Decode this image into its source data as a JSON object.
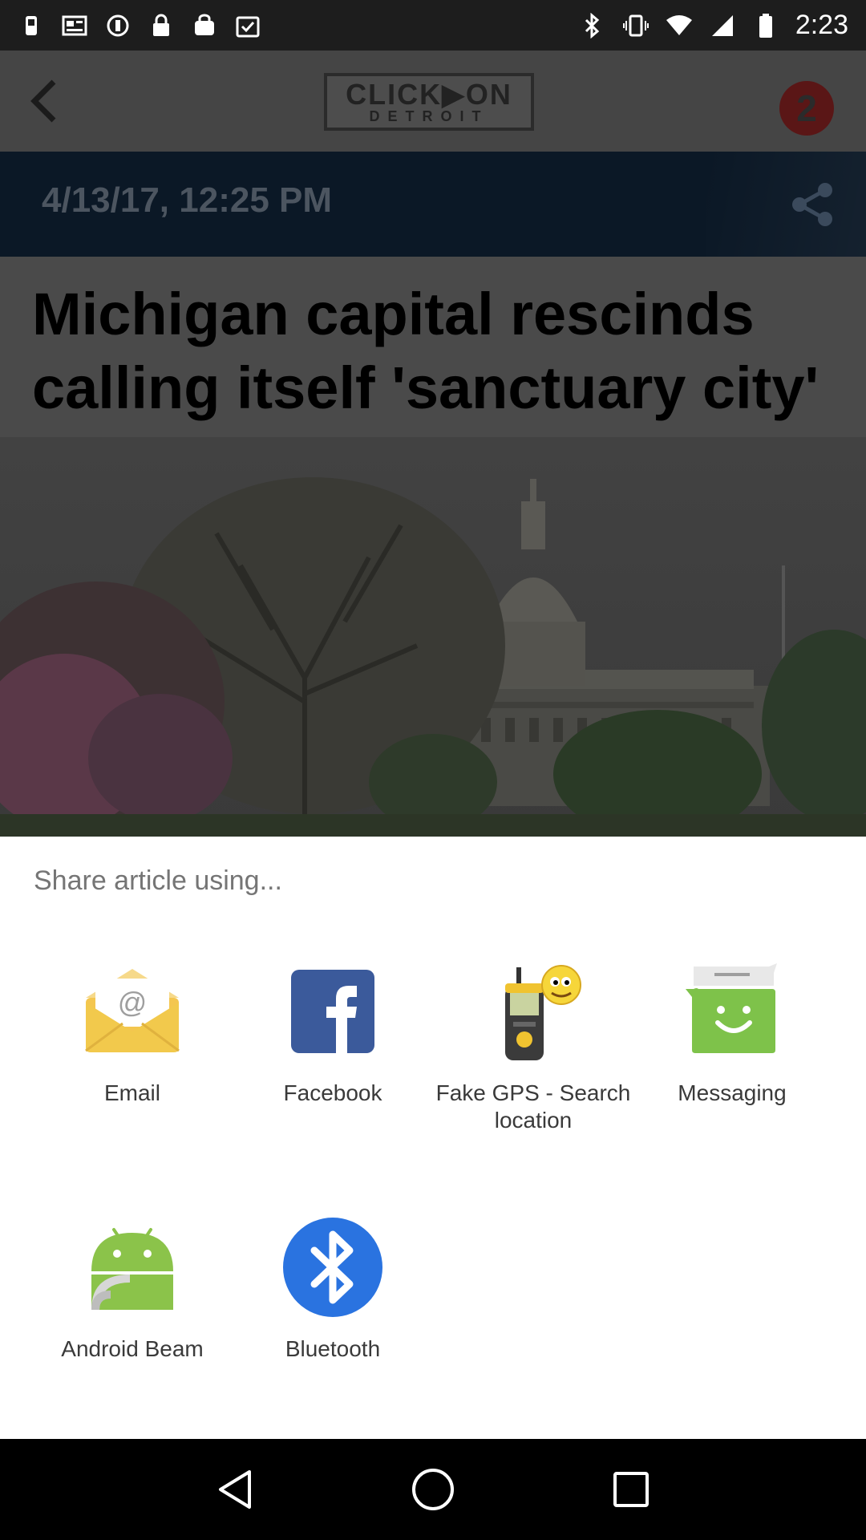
{
  "status_bar": {
    "time": "2:23",
    "left_icons": [
      "fake-gps-icon",
      "news-icon",
      "circle-icon",
      "lock-icon",
      "bag-icon",
      "clipboard-check-icon"
    ],
    "right_icons": [
      "bluetooth-icon",
      "vibrate-icon",
      "wifi-icon",
      "signal-icon",
      "battery-icon"
    ]
  },
  "app_bar": {
    "logo_top": "CLICK▶ON",
    "logo_bottom": "DETROIT",
    "badge": "2"
  },
  "article": {
    "date": "4/13/17, 12:25 PM",
    "headline": "Michigan capital rescinds calling itself 'sanctuary city'"
  },
  "share_sheet": {
    "title": "Share article using...",
    "apps": [
      {
        "label": "Email",
        "icon": "email-icon"
      },
      {
        "label": "Facebook",
        "icon": "facebook-icon"
      },
      {
        "label": "Fake GPS - Search location",
        "icon": "fake-gps-icon"
      },
      {
        "label": "Messaging",
        "icon": "messaging-icon"
      },
      {
        "label": "Android Beam",
        "icon": "android-beam-icon"
      },
      {
        "label": "Bluetooth",
        "icon": "bluetooth-icon"
      }
    ]
  },
  "nav_bar": {
    "buttons": [
      "back-icon",
      "home-icon",
      "recents-icon"
    ]
  },
  "colors": {
    "sheet_bg": "#ffffff",
    "label_text": "#3a3a3a",
    "facebook_blue": "#3b5a9b",
    "bluetooth_blue": "#2a73e0",
    "messaging_green": "#7ec24a",
    "email_yellow": "#f2c94c"
  }
}
